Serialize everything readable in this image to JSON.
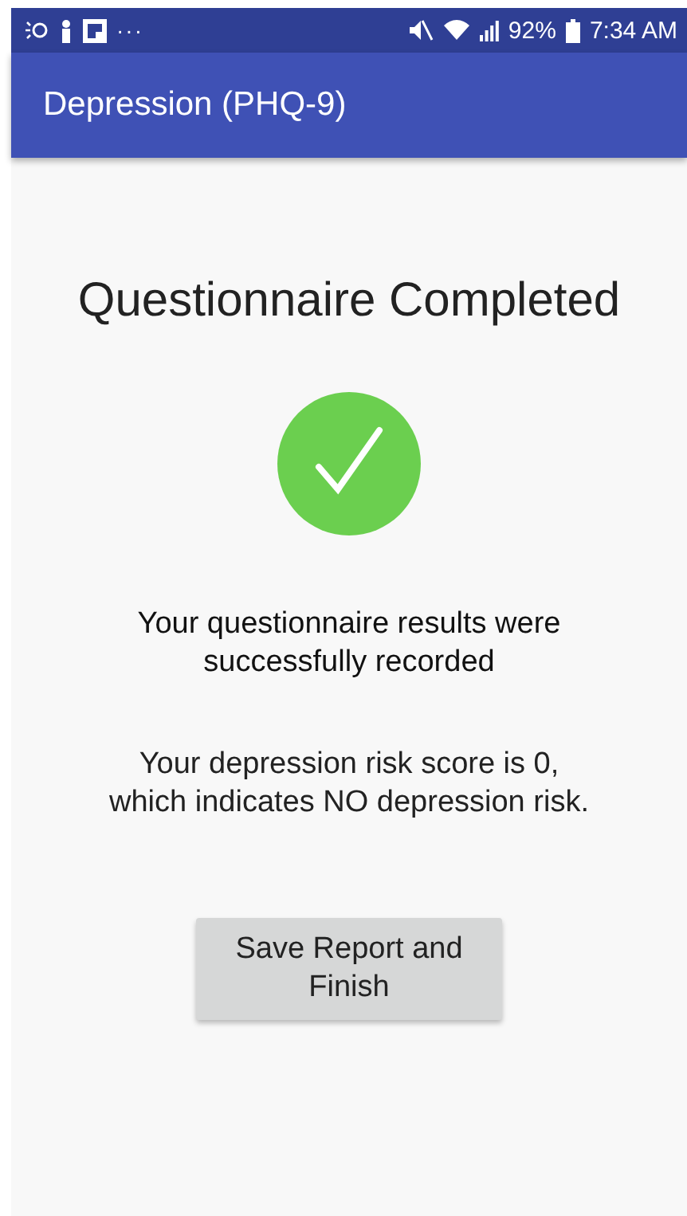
{
  "status_bar": {
    "more": "···",
    "battery": "92%",
    "time": "7:34 AM"
  },
  "app_bar": {
    "title": "Depression (PHQ-9)"
  },
  "content": {
    "heading": "Questionnaire Completed",
    "message": "Your questionnaire results were successfully recorded",
    "result": "Your depression risk score is 0, which indicates NO depression risk.",
    "button": "Save Report and Finish"
  }
}
